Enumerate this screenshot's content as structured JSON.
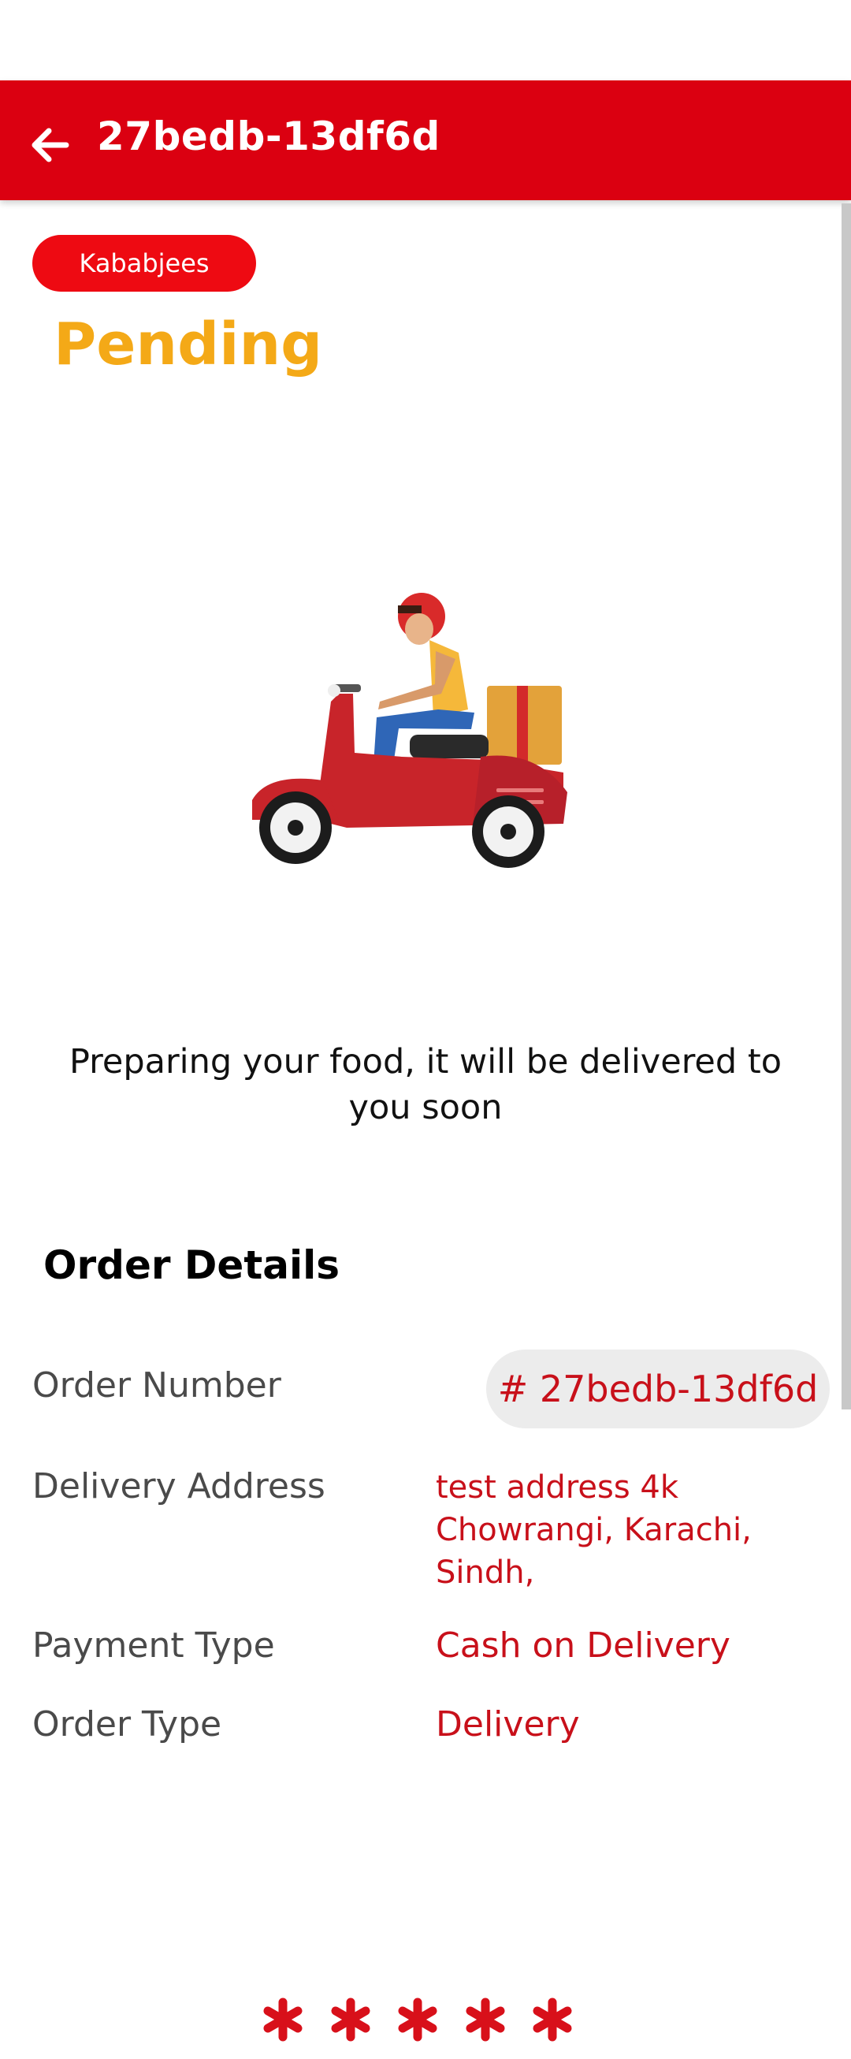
{
  "header": {
    "title": "27bedb-13df6d",
    "back_icon": "arrow-left-icon",
    "background_color": "#db0011"
  },
  "restaurant": {
    "name": "Kababjees",
    "chip_color": "#ee0a12"
  },
  "status": {
    "label": "Pending",
    "color": "#f4a917",
    "message": "Preparing your food, it will be delivered to you soon",
    "illustration": "delivery-scooter-illustration"
  },
  "order_details": {
    "title": "Order Details",
    "rows": [
      {
        "label": "Order Number",
        "value": "# 27bedb-13df6d"
      },
      {
        "label": "Delivery Address",
        "value": "test address  4k Chowrangi, Karachi, Sindh,"
      },
      {
        "label": "Payment Type",
        "value": "Cash on Delivery"
      },
      {
        "label": "Order Type",
        "value": "Delivery"
      }
    ],
    "value_color": "#c8101a"
  },
  "rating": {
    "stars": 5,
    "icon": "asterisk-star-icon",
    "color": "#d8101a"
  }
}
